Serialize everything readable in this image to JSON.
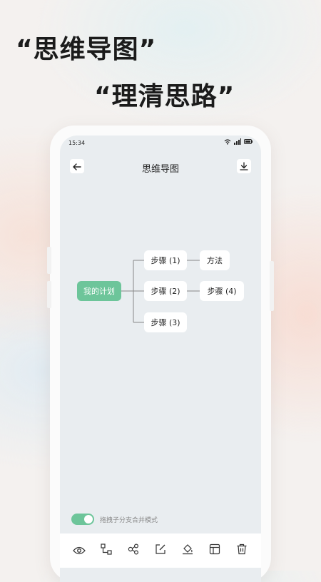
{
  "promo": {
    "line1": "“思维导图”",
    "line2": "“理清思路”"
  },
  "status_bar": {
    "time": "15:34",
    "icons": [
      "wifi-icon",
      "signal-icon",
      "battery-icon"
    ]
  },
  "app_bar": {
    "title": "思维导图",
    "left_icon": "back-arrow-icon",
    "right_icon": "download-icon"
  },
  "mind_map": {
    "root": "我的计划",
    "children": [
      {
        "label": "步骤 (1)",
        "child": "方法"
      },
      {
        "label": "步骤 (2)",
        "child": "步骤 (4)"
      },
      {
        "label": "步骤 (3)",
        "child": null
      }
    ]
  },
  "toggle": {
    "label": "拖拽子分支合并模式",
    "on": true
  },
  "toolbar": {
    "icons": [
      "eye-icon",
      "add-child-node-icon",
      "add-sibling-node-icon",
      "edit-icon",
      "fill-color-icon",
      "layout-icon",
      "delete-icon"
    ]
  },
  "colors": {
    "accent": "#6dc59a",
    "canvas": "#e9edf0"
  }
}
